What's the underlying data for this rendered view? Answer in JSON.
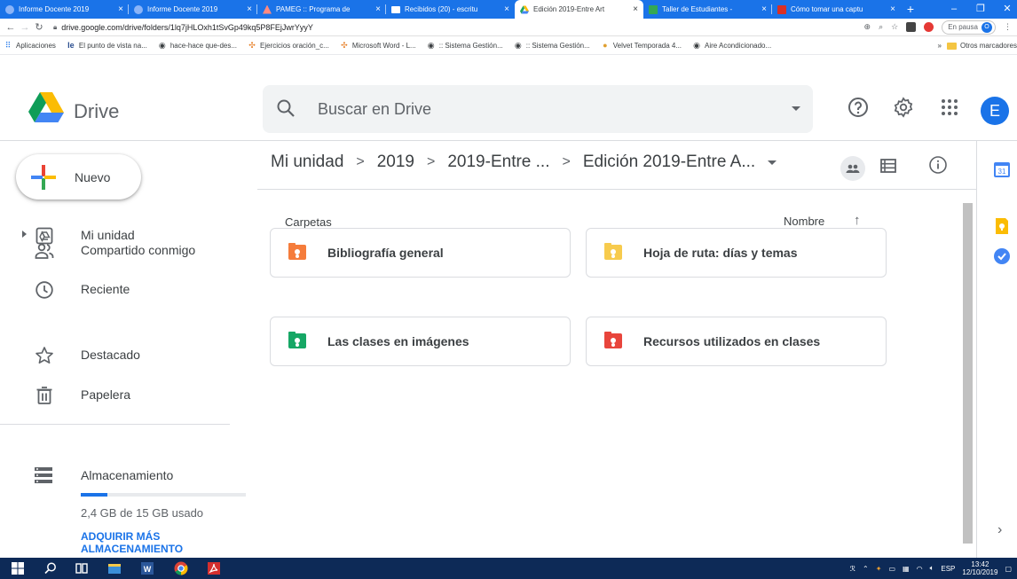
{
  "browser": {
    "tabs": [
      {
        "title": "Informe Docente 2019",
        "fav_color": "#1a73e8"
      },
      {
        "title": "Informe Docente 2019",
        "fav_color": "#1a73e8"
      },
      {
        "title": "PAMEG :: Programa de",
        "fav_color": "#e8453c"
      },
      {
        "title": "Recibidos (20) - escritu",
        "fav_color": "#ea4335"
      },
      {
        "title": "Edición 2019-Entre Art",
        "fav_color": "#fbbc04"
      },
      {
        "title": "Taller de Estudiantes -",
        "fav_color": "#34a853"
      },
      {
        "title": "Cómo tomar una captu",
        "fav_color": "#d93025"
      }
    ],
    "new_tab": "+",
    "url": "drive.google.com/drive/folders/1lq7jHLOxh1tSvGp49kq5P8FEjJwrYyyY",
    "paused_label": "En pausa",
    "profile_initial": "O",
    "bookmarks": [
      {
        "label": "Aplicaciones",
        "icon": "apps-grid-icon"
      },
      {
        "label": "El punto de vista na...",
        "icon": "bookmark-icon"
      },
      {
        "label": "hace-hace que-des...",
        "icon": "globe-icon"
      },
      {
        "label": "Ejercicios oración_c...",
        "icon": "pinwheel-icon"
      },
      {
        "label": "Microsoft Word - L...",
        "icon": "pinwheel-icon"
      },
      {
        "label": ":: Sistema Gestión...",
        "icon": "globe-icon"
      },
      {
        "label": ":: Sistema Gestión...",
        "icon": "globe-icon"
      },
      {
        "label": "Velvet Temporada 4...",
        "icon": "bookmark-icon"
      },
      {
        "label": "Aire Acondicionado...",
        "icon": "globe-icon"
      }
    ],
    "more_bookmarks": "»",
    "other_bookmarks": "Otros marcadores"
  },
  "drive": {
    "logo_text": "Drive",
    "search_placeholder": "Buscar en Drive",
    "avatar_initial": "E",
    "new_button": "Nuevo",
    "nav": [
      {
        "label": "Mi unidad",
        "icon": "my-drive-icon"
      },
      {
        "label": "Compartido conmigo",
        "icon": "shared-icon"
      },
      {
        "label": "Reciente",
        "icon": "clock-icon"
      },
      {
        "label": "Destacado",
        "icon": "star-icon"
      },
      {
        "label": "Papelera",
        "icon": "trash-icon"
      }
    ],
    "storage": {
      "label": "Almacenamiento",
      "used_text": "2,4 GB de 15 GB usado",
      "used_fraction": 0.16,
      "buy_more": "ADQUIRIR MÁS ALMACENAMIENTO"
    },
    "breadcrumb": [
      "Mi unidad",
      "2019",
      "2019-Entre ...",
      "Edición 2019-Entre A..."
    ],
    "section_title": "Carpetas",
    "sort_label": "Nombre",
    "sort_arrow": "↑",
    "folders": [
      {
        "name": "Bibliografía general",
        "color": "#f57c3b"
      },
      {
        "name": "Hoja de ruta: días y temas",
        "color": "#f7cb4d"
      },
      {
        "name": "Las clases en imágenes",
        "color": "#16a765"
      },
      {
        "name": "Recursos utilizados en clases",
        "color": "#e8453c"
      }
    ]
  },
  "taskbar": {
    "language": "ESP",
    "time": "13:42",
    "date": "12/10/2019"
  }
}
